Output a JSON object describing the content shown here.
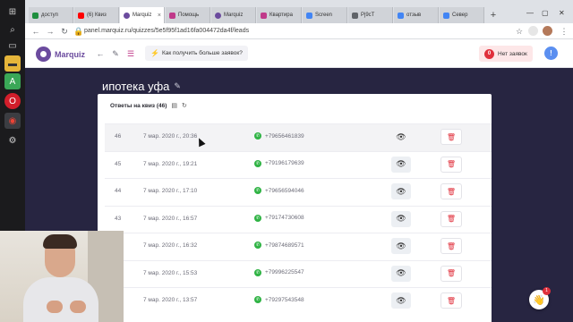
{
  "browser": {
    "tabs": [
      {
        "label": "доступ",
        "color": "#1e8e3e"
      },
      {
        "label": "(6) Квиз",
        "color": "#ff0000"
      },
      {
        "label": "Marquiz",
        "color": "#6b4b9e"
      },
      {
        "label": "Помощь",
        "color": "#c03a8a"
      },
      {
        "label": "Marquiz",
        "color": "#6b4b9e"
      },
      {
        "label": "Квартира",
        "color": "#c03a8a"
      },
      {
        "label": "Screen",
        "color": "#4285f4"
      },
      {
        "label": "Pj9cT",
        "color": "#5f6368"
      },
      {
        "label": "отзыв",
        "color": "#4285f4"
      },
      {
        "label": "Север",
        "color": "#4285f4"
      }
    ],
    "new_tab": "+",
    "url": "panel.marquiz.ru/quizzes/5e5f95f1ad16fa004472da4f/leads"
  },
  "app": {
    "logo": "Marquiz",
    "get_leads_label": "Как получить больше заявок?",
    "no_leads_count": "0",
    "no_leads_label": "Нет заявок",
    "info": "!"
  },
  "page": {
    "title": "ипотека уфа",
    "card_title": "Ответы на квиз (46)"
  },
  "leads": [
    {
      "num": "46",
      "date": "7 мар. 2020 г., 20:36",
      "phone": "+79656461839"
    },
    {
      "num": "45",
      "date": "7 мар. 2020 г., 19:21",
      "phone": "+79196179639"
    },
    {
      "num": "44",
      "date": "7 мар. 2020 г., 17:10",
      "phone": "+79656594046"
    },
    {
      "num": "43",
      "date": "7 мар. 2020 г., 16:57",
      "phone": "+79174730608"
    },
    {
      "num": "42",
      "date": "7 мар. 2020 г., 16:32",
      "phone": "+79874689571"
    },
    {
      "num": "41",
      "date": "7 мар. 2020 г., 15:53",
      "phone": "+79996225547"
    },
    {
      "num": "40",
      "date": "7 мар. 2020 г., 13:57",
      "phone": "+79297543548"
    }
  ],
  "chat": {
    "badge": "1"
  },
  "colors": {
    "brand": "#6b4b9e",
    "content_bg": "#272541",
    "danger": "#e0303c",
    "whatsapp": "#2fb344"
  }
}
